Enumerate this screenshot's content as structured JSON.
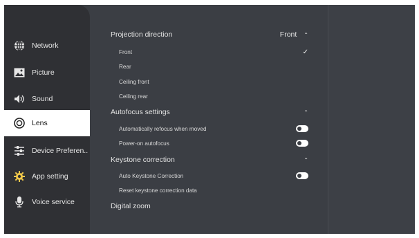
{
  "sidebar": {
    "items": [
      {
        "label": "Network",
        "icon": "globe-icon"
      },
      {
        "label": "Picture",
        "icon": "picture-icon"
      },
      {
        "label": "Sound",
        "icon": "speaker-icon"
      },
      {
        "label": "Lens",
        "icon": "lens-icon",
        "active": true
      },
      {
        "label": "Device Preferen..",
        "icon": "sliders-icon"
      },
      {
        "label": "App setting",
        "icon": "gear-icon"
      },
      {
        "label": "Voice service",
        "icon": "microphone-icon"
      }
    ]
  },
  "lens": {
    "projection": {
      "title": "Projection direction",
      "value": "Front",
      "options": [
        "Front",
        "Rear",
        "Ceiling front",
        "Ceiling rear"
      ],
      "selected": "Front"
    },
    "autofocus": {
      "title": "Autofocus settings",
      "items": [
        {
          "label": "Automatically refocus when moved",
          "on": true
        },
        {
          "label": "Power-on autofocus",
          "on": true
        }
      ]
    },
    "keystone": {
      "title": "Keystone correction",
      "items": [
        {
          "label": "Auto Keystone Correction",
          "on": true
        },
        {
          "label": "Reset keystone correction data"
        }
      ]
    },
    "zoom": {
      "title": "Digital zoom"
    }
  },
  "colors": {
    "sidebar_bg": "#2f3034",
    "panel_bg": "#3b3e44",
    "active_item_bg": "#ffffff",
    "text": "#e2e2e2"
  }
}
